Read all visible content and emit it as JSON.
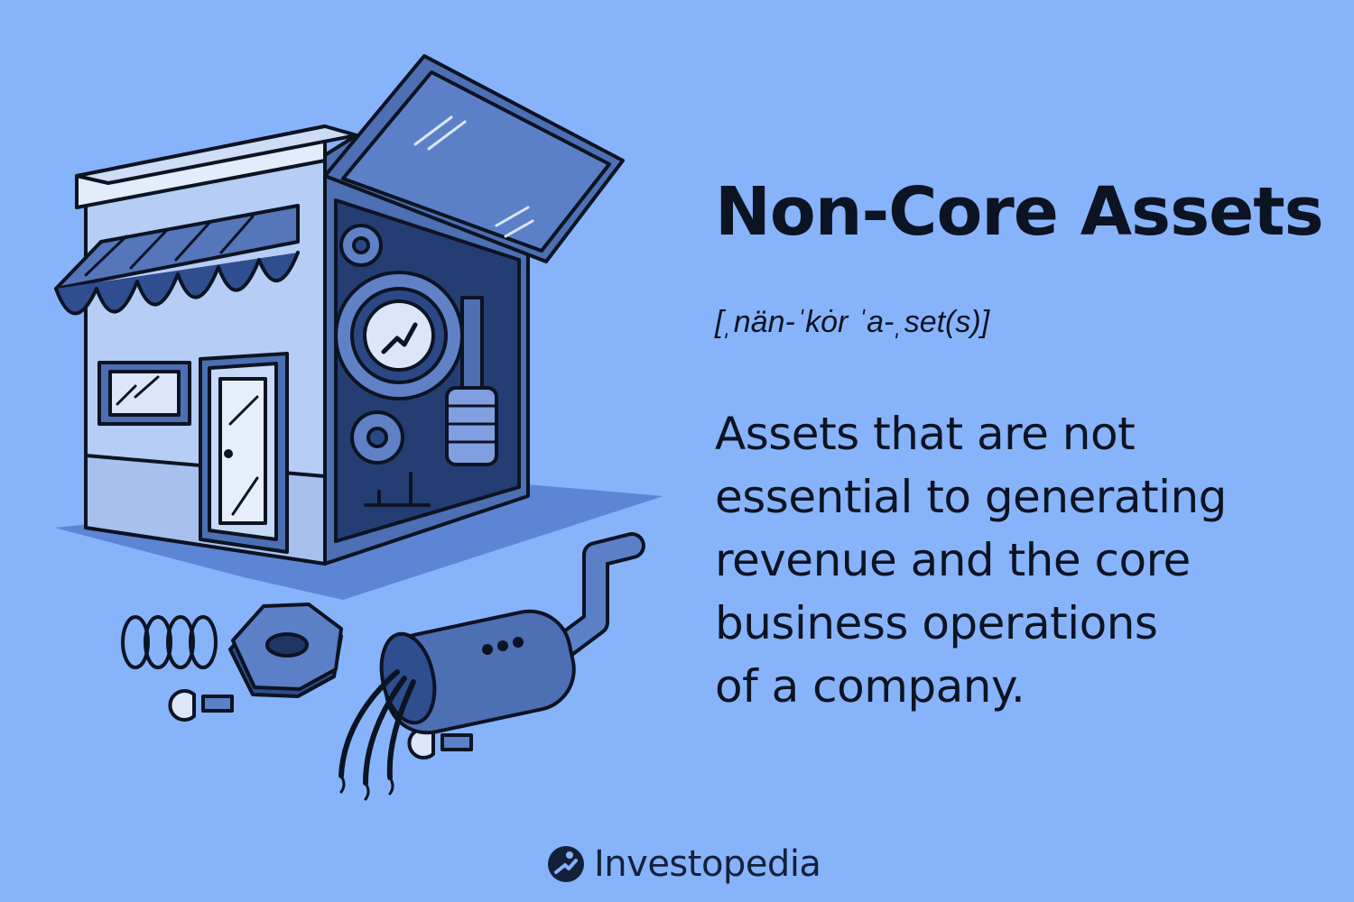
{
  "title": "Non-Core Assets",
  "pronunciation": "[ˌnän-ˈkȯr ˈa-ˌset(s)]",
  "definition_lines": [
    "Assets that are not",
    "essential to generating",
    "revenue and the core",
    "business operations",
    "of a company."
  ],
  "brand": {
    "name": "Investopedia",
    "icon": "investopedia-logo-icon"
  },
  "colors": {
    "background": "#87b3fb",
    "ink": "#0c1322",
    "illustration_dark": "#3f65a8"
  }
}
